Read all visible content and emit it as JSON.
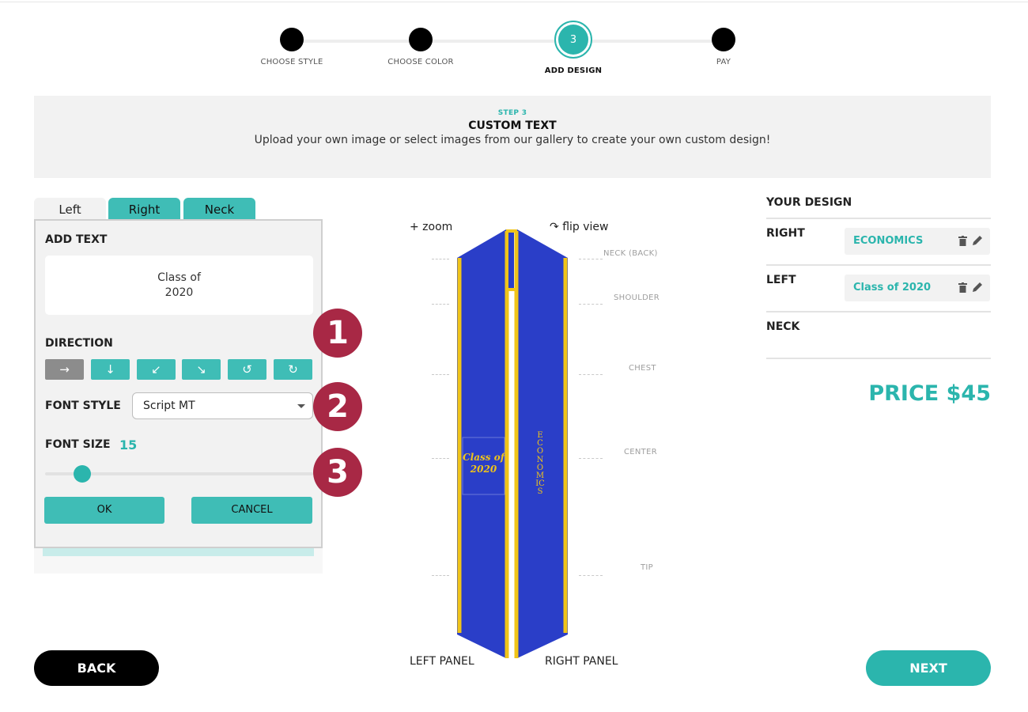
{
  "stepper": {
    "steps": [
      {
        "label": "CHOOSE STYLE"
      },
      {
        "label": "CHOOSE COLOR"
      },
      {
        "label": "ADD DESIGN",
        "number": "3"
      },
      {
        "label": "PAY"
      }
    ]
  },
  "header": {
    "kicker": "STEP 3",
    "title": "CUSTOM TEXT",
    "subtitle": "Upload your own image or select images from our gallery to create your own custom design!"
  },
  "tabs": [
    {
      "label": "Left"
    },
    {
      "label": "Right"
    },
    {
      "label": "Neck"
    }
  ],
  "editor": {
    "add_text_label": "ADD TEXT",
    "text_line1": "Class of",
    "text_line2": "2020",
    "direction_label": "DIRECTION",
    "directions": [
      "→",
      "↓",
      "↙",
      "↘",
      "↺",
      "↻"
    ],
    "font_style_label": "FONT STYLE",
    "font_style_value": "Script MT",
    "font_size_label": "FONT SIZE",
    "font_size_value": "15",
    "ok_label": "OK",
    "cancel_label": "CANCEL"
  },
  "callouts": [
    "1",
    "2",
    "3"
  ],
  "preview": {
    "zoom_label": "+ zoom",
    "flip_label": "flip view",
    "markers": [
      "NECK (BACK)",
      "SHOULDER",
      "CHEST",
      "CENTER",
      "TIP"
    ],
    "left_text_line1": "Class of",
    "left_text_line2": "2020",
    "right_text": "ECONOMICS",
    "left_panel_label": "LEFT PANEL",
    "right_panel_label": "RIGHT PANEL",
    "colors": {
      "stole": "#2a3ec8",
      "trim": "#f0c419",
      "text": "#f0c419"
    }
  },
  "design": {
    "title": "YOUR DESIGN",
    "rows": [
      {
        "key": "RIGHT",
        "value": "ECONOMICS"
      },
      {
        "key": "LEFT",
        "value": "Class of 2020"
      },
      {
        "key": "NECK",
        "value": ""
      }
    ]
  },
  "price": "PRICE $45",
  "nav": {
    "back": "BACK",
    "next": "NEXT"
  },
  "colors": {
    "accent": "#2bb5ad",
    "callout": "#a82845"
  }
}
